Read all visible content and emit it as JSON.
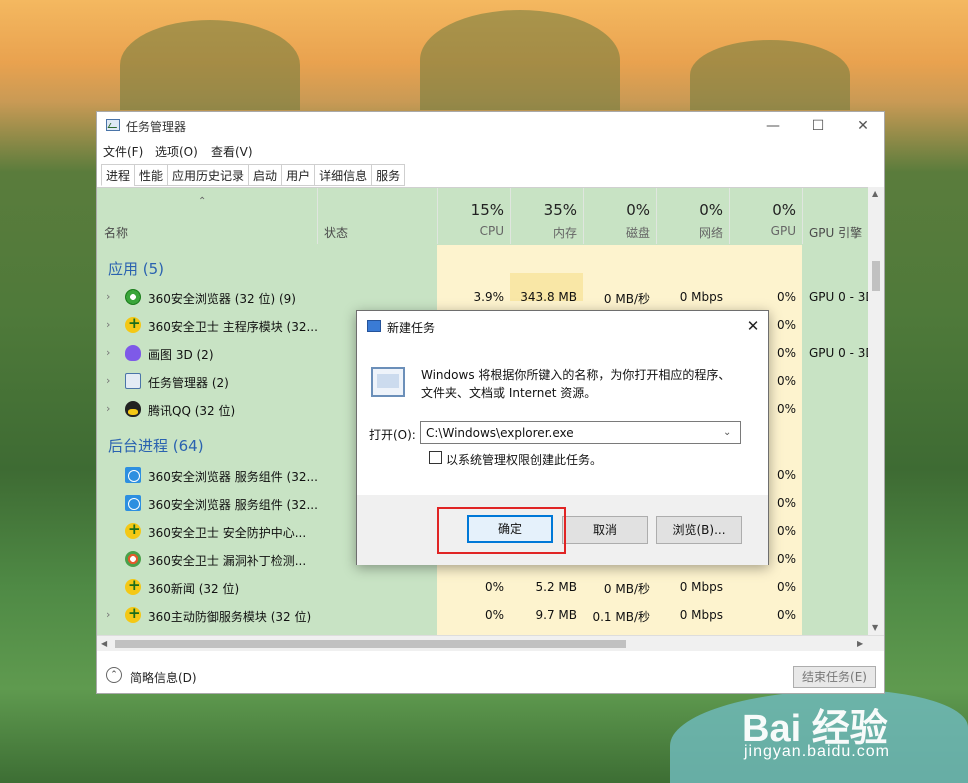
{
  "window": {
    "title": "任务管理器",
    "minimize": "—",
    "maximize": "☐",
    "close": "✕"
  },
  "menu": [
    "文件(F)",
    "选项(O)",
    "查看(V)"
  ],
  "tabs": [
    "进程",
    "性能",
    "应用历史记录",
    "启动",
    "用户",
    "详细信息",
    "服务"
  ],
  "columns": {
    "name": "名称",
    "status": "状态",
    "cpu": {
      "pct": "15%",
      "label": "CPU"
    },
    "mem": {
      "pct": "35%",
      "label": "内存"
    },
    "disk": {
      "pct": "0%",
      "label": "磁盘"
    },
    "net": {
      "pct": "0%",
      "label": "网络"
    },
    "gpu": {
      "pct": "0%",
      "label": "GPU"
    },
    "gpu_engine": "GPU 引擎"
  },
  "groups": {
    "apps": "应用 (5)",
    "background": "后台进程 (64)"
  },
  "rows": [
    {
      "name": "360安全浏览器 (32 位) (9)",
      "cpu": "3.9%",
      "mem": "343.8 MB",
      "disk": "0 MB/秒",
      "net": "0 Mbps",
      "gpu": "0%",
      "engine": "GPU 0 - 3D"
    },
    {
      "name": "360安全卫士 主程序模块 (32...",
      "gpu": "0%"
    },
    {
      "name": "画图 3D (2)",
      "gpu": "0%",
      "engine": "GPU 0 - 3D"
    },
    {
      "name": "任务管理器 (2)",
      "gpu": "0%"
    },
    {
      "name": "腾讯QQ (32 位)",
      "gpu": "0%"
    },
    {
      "name": "360安全浏览器 服务组件 (32...",
      "gpu": "0%"
    },
    {
      "name": "360安全浏览器 服务组件 (32...",
      "gpu": "0%"
    },
    {
      "name": "360安全卫士 安全防护中心...",
      "gpu": "0%"
    },
    {
      "name": "360安全卫士 漏洞补丁检测...",
      "gpu": "0%"
    },
    {
      "name": "360新闻 (32 位)",
      "cpu": "0%",
      "mem": "5.2 MB",
      "disk": "0 MB/秒",
      "net": "0 Mbps",
      "gpu": "0%"
    },
    {
      "name": "360主动防御服务模块 (32 位)",
      "cpu": "0%",
      "mem": "9.7 MB",
      "disk": "0.1 MB/秒",
      "net": "0 Mbps",
      "gpu": "0%"
    }
  ],
  "footer": {
    "brief": "简略信息(D)",
    "end_task": "结束任务(E)"
  },
  "dialog": {
    "title": "新建任务",
    "close": "✕",
    "desc_line1": "Windows 将根据你所键入的名称，为你打开相应的程序、",
    "desc_line2": "文件夹、文档或 Internet 资源。",
    "open_label": "打开(O):",
    "open_value": "C:\\Windows\\explorer.exe",
    "admin_label": "以系统管理权限创建此任务。",
    "ok": "确定",
    "cancel": "取消",
    "browse": "浏览(B)..."
  },
  "watermark": {
    "logo": "Bai 经验",
    "url": "jingyan.baidu.com"
  },
  "colors": {
    "heat_light": "#fdf3ce",
    "heat_hot": "#f9e7a6",
    "content_bg": "#c8e3c4",
    "group_text": "#2a62b0",
    "highlight_box": "#e02424",
    "primary_border": "#0078d7"
  }
}
